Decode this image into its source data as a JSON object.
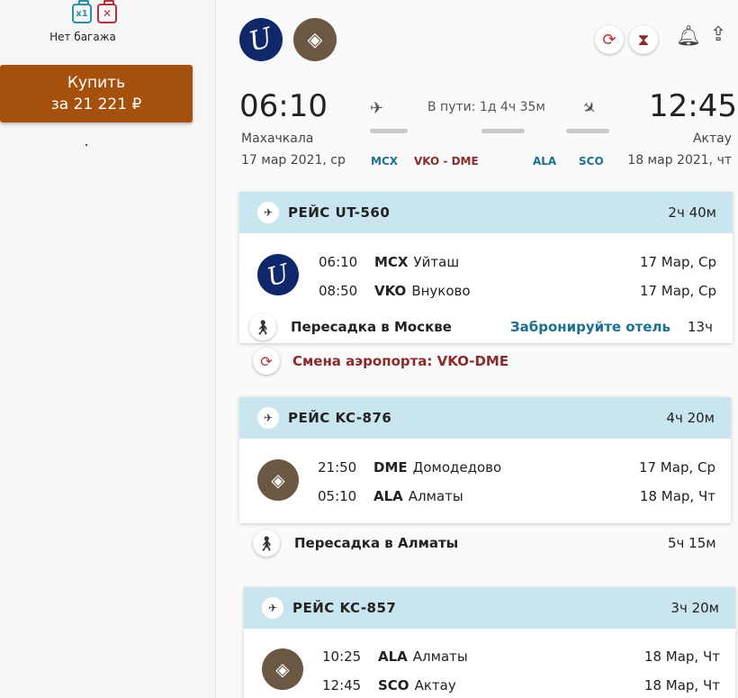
{
  "baggage": {
    "hand_badge": "x1",
    "bag_badge": "✕",
    "label": "Нет багажа"
  },
  "buy": {
    "line1": "Купить",
    "line2": "за 21 221 ₽"
  },
  "summary": {
    "dep_time": "06:10",
    "dep_city": "Махачкала",
    "dep_date": "17 мар 2021, ср",
    "arr_time": "12:45",
    "arr_city": "Актау",
    "arr_date": "18 мар 2021, чт",
    "in_transit": "В пути: 1д 4ч 35м",
    "codes": [
      "MCX",
      "VKO - DME",
      "ALA",
      "SCO"
    ]
  },
  "flights": [
    {
      "number": "РЕЙС UT-560",
      "duration": "2ч 40м",
      "dep": {
        "time": "06:10",
        "code": "MCX",
        "airport": "Уйташ",
        "date": "17 Мар, Ср"
      },
      "arr": {
        "time": "08:50",
        "code": "VKO",
        "airport": "Внуково",
        "date": "17 Мар, Ср"
      }
    },
    {
      "number": "РЕЙС KC-876",
      "duration": "4ч 20м",
      "dep": {
        "time": "21:50",
        "code": "DME",
        "airport": "Домодедово",
        "date": "17 Мар, Ср"
      },
      "arr": {
        "time": "05:10",
        "code": "ALA",
        "airport": "Алматы",
        "date": "18 Мар, Чт"
      }
    },
    {
      "number": "РЕЙС KC-857",
      "duration": "3ч 20м",
      "dep": {
        "time": "10:25",
        "code": "ALA",
        "airport": "Алматы",
        "date": "18 Мар, Чт"
      },
      "arr": {
        "time": "12:45",
        "code": "SCO",
        "airport": "Актау",
        "date": "18 Мар, Чт"
      }
    }
  ],
  "transfers": [
    {
      "text": "Пересадка в Москве",
      "hotel_link": "Забронируйте отель",
      "duration": "13ч"
    },
    {
      "text": "Пересадка в Алматы",
      "duration": "5ч 15м"
    }
  ],
  "airport_change": "Смена аэропорта: VKO-DME",
  "colors": {
    "accent": "#a6500e",
    "header": "#c9e5f0",
    "link": "#1c6f90",
    "warning": "#8a2b2b"
  }
}
